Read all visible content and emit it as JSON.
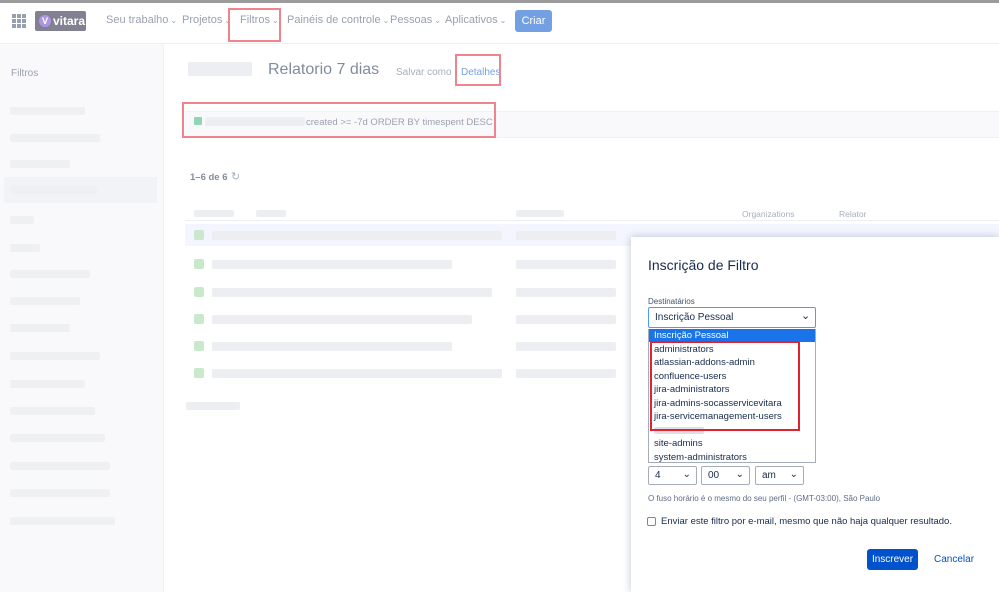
{
  "topnav": {
    "logo_text": "vitara",
    "items": [
      {
        "label": "Seu trabalho"
      },
      {
        "label": "Projetos"
      },
      {
        "label": "Filtros"
      },
      {
        "label": "Painéis de controle"
      },
      {
        "label": "Pessoas"
      },
      {
        "label": "Aplicativos"
      }
    ],
    "create_label": "Criar"
  },
  "sidebar": {
    "title": "Filtros"
  },
  "filter": {
    "title": "Relatorio 7 dias",
    "save_as": "Salvar como",
    "details": "Detalhes",
    "query_text": "created >= -7d ORDER BY timespent DESC"
  },
  "results": {
    "count_label": "1–6 de 6",
    "columns": [
      "Organizations",
      "Relator"
    ]
  },
  "modal": {
    "title": "Inscrição de Filtro",
    "recipients_label": "Destinatários",
    "recipients_value": "Inscrição Pessoal",
    "options": [
      "Inscrição Pessoal",
      "administrators",
      "atlassian-addons-admin",
      "confluence-users",
      "jira-administrators",
      "jira-admins-socasservicevitara",
      "jira-servicemanagement-users",
      "site-admins",
      "system-administrators"
    ],
    "hour": "4",
    "minute": "00",
    "ampm": "am",
    "timezone_note": "O fuso horário é o mesmo do seu perfil - (GMT-03:00), São Paulo",
    "email_checkbox_label": "Enviar este filtro por e-mail, mesmo que não haja qualquer resultado.",
    "subscribe_label": "Inscrever",
    "cancel_label": "Cancelar"
  },
  "colors": {
    "accent": "#0052cc",
    "highlight": "#e2222f",
    "dropdown_selected": "#1a73e8"
  }
}
